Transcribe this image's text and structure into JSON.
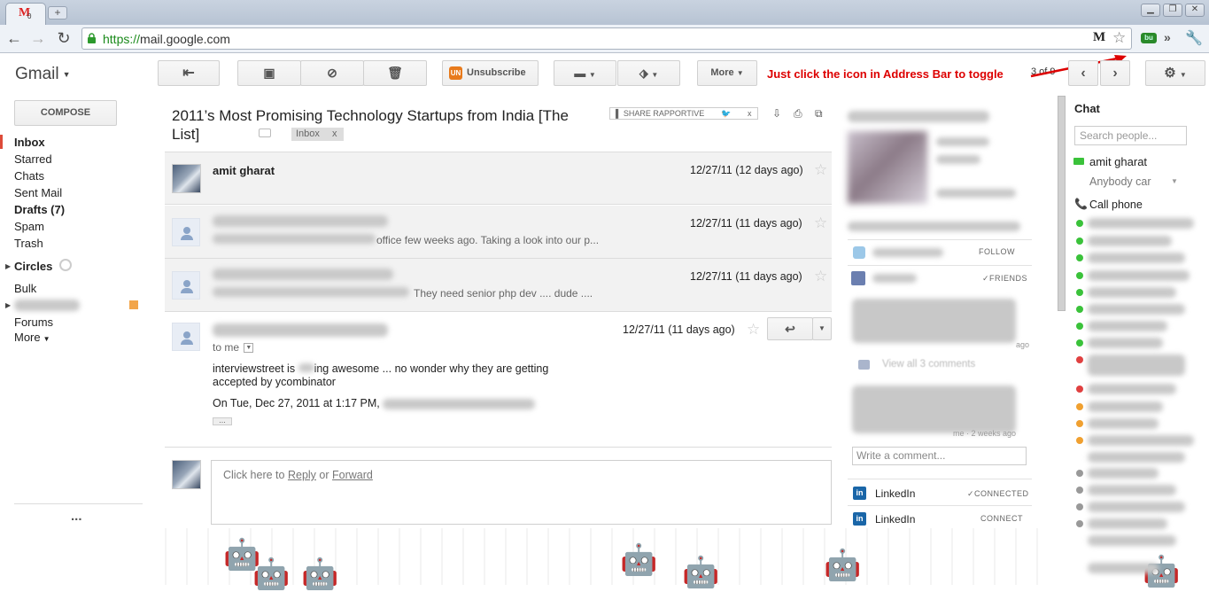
{
  "browser": {
    "tab_badge": "0",
    "new_tab_label": "+",
    "url_scheme": "https://",
    "url_host": "mail.google.com"
  },
  "header": {
    "app_name": "Gmail",
    "unsubscribe_label": "Unsubscribe",
    "more_label": "More",
    "annotation": "Just click the icon in Address Bar to toggle",
    "pager": "3 of 9"
  },
  "sidebar": {
    "compose_label": "COMPOSE",
    "items": [
      {
        "label": "Inbox",
        "bold": true
      },
      {
        "label": "Starred"
      },
      {
        "label": "Chats"
      },
      {
        "label": "Sent Mail"
      },
      {
        "label": "Drafts (7)",
        "bold": true
      },
      {
        "label": "Spam"
      },
      {
        "label": "Trash"
      }
    ],
    "circles_label": "Circles",
    "bulk_label": "Bulk",
    "forums_label": "Forums",
    "more_label": "More",
    "ellipsis": "..."
  },
  "thread": {
    "subject": "2011’s Most Promising Technology Startups from India [The List]",
    "label_chip": "Inbox",
    "label_chip_close": "x",
    "share_widget": "SHARE RAPPORTIVE",
    "messages": [
      {
        "sender": "amit gharat",
        "date": "12/27/11 (12 days ago)"
      },
      {
        "sender": "",
        "date": "12/27/11 (11 days ago)",
        "snippet": "office few weeks ago. Taking a look into our p..."
      },
      {
        "sender": "",
        "date": "12/27/11 (11 days ago)",
        "snippet": "They need senior php dev .... dude ...."
      },
      {
        "sender": "",
        "date": "12/27/11 (11 days ago)",
        "to_label": "to me",
        "body_line1": "interviewstreet is ",
        "body_line1b": "ing awesome ... no wonder why they are getting",
        "body_line2": "accepted by ycombinator",
        "quote_intro": "On Tue, Dec 27, 2011 at 1:17 PM,",
        "quote_toggle": "..."
      }
    ],
    "reply_prefix": "Click here to",
    "reply_link": "Reply",
    "reply_or": "or",
    "forward_link": "Forward"
  },
  "rapportive": {
    "follow_label": "FOLLOW",
    "friends_label": "✓FRIENDS",
    "view_all": "View all 3 comments",
    "comment_placeholder": "Write a comment...",
    "networks": [
      {
        "name": "LinkedIn",
        "status": "✓CONNECTED"
      },
      {
        "name": "LinkedIn",
        "status": "CONNECT"
      }
    ],
    "ago1": "ago",
    "ago2": "me · 2 weeks ago"
  },
  "chat": {
    "title": "Chat",
    "search_placeholder": "Search people...",
    "self_name": "amit gharat",
    "status_text": "Anybody car",
    "call_phone": "Call phone"
  },
  "colors": {
    "accent_red": "#dd0000",
    "link_blue": "#1155cc",
    "online_green": "#3ac23a",
    "away_orange": "#f0a030"
  }
}
